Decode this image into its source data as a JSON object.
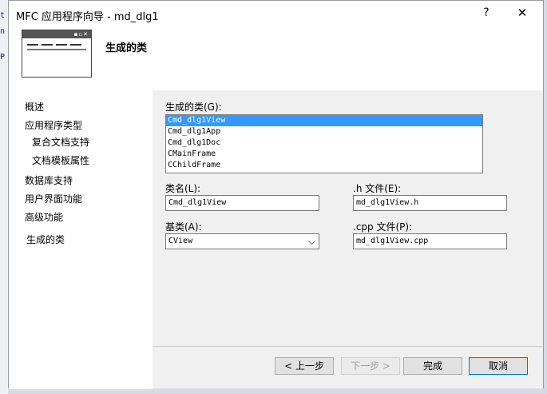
{
  "background": {
    "fragments": [
      "t",
      "n",
      "P"
    ]
  },
  "window": {
    "title": "MFC 应用程序向导 - md_dlg1",
    "help": "?",
    "close": "✕"
  },
  "header": {
    "icon": "wizard-window-icon",
    "heading": "生成的类"
  },
  "nav": {
    "items": [
      {
        "label": "概述"
      },
      {
        "label": "应用程序类型"
      },
      {
        "label": "复合文档支持"
      },
      {
        "label": "文档模板属性"
      },
      {
        "label": "数据库支持"
      },
      {
        "label": "用户界面功能"
      },
      {
        "label": "高级功能"
      },
      {
        "label": "生成的类"
      }
    ]
  },
  "classes": {
    "label": "生成的类(G):",
    "list": [
      "Cmd_dlg1View",
      "Cmd_dlg1App",
      "Cmd_dlg1Doc",
      "CMainFrame",
      "CChildFrame"
    ],
    "selected": "Cmd_dlg1View"
  },
  "class_name": {
    "label": "类名(L):",
    "value": "Cmd_dlg1View"
  },
  "h_file": {
    "label": ".h 文件(E):",
    "value": "md_dlg1View.h"
  },
  "base_class": {
    "label": "基类(A):",
    "value": "CView"
  },
  "cpp_file": {
    "label": ".cpp 文件(P):",
    "value": "md_dlg1View.cpp"
  },
  "buttons": {
    "prev": "< 上一步",
    "next": "下一步 >",
    "finish": "完成",
    "cancel": "取消"
  }
}
